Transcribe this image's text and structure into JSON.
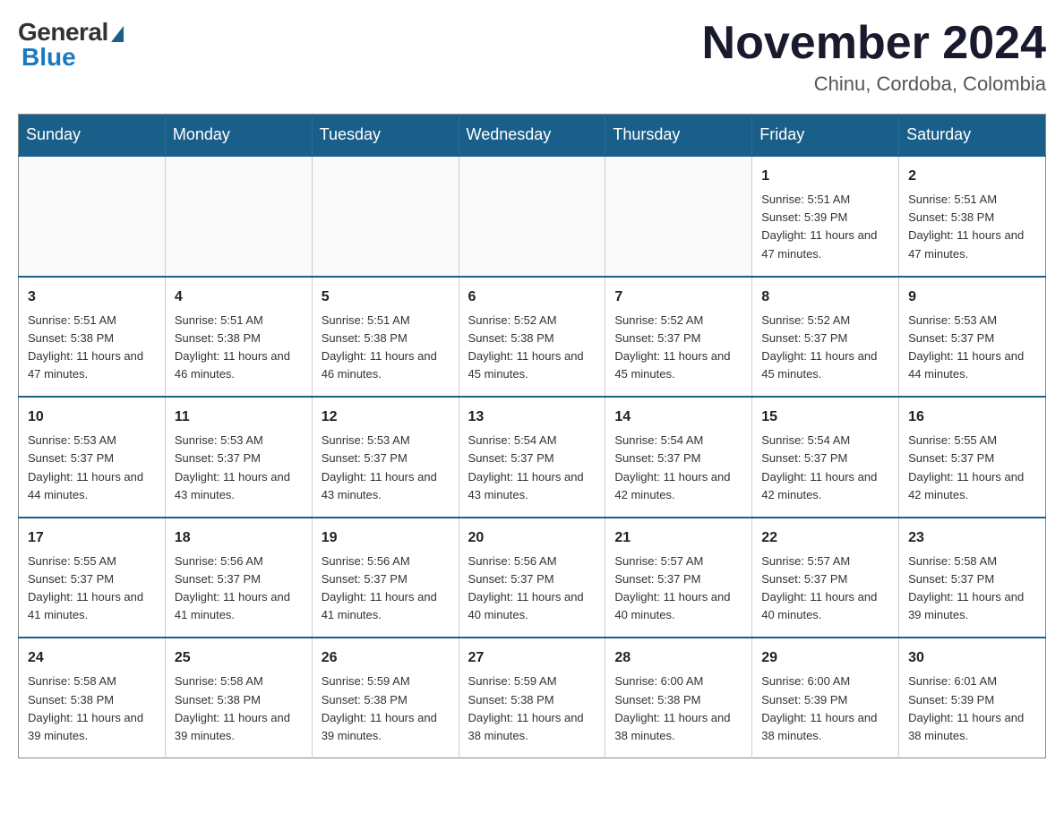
{
  "header": {
    "logo": {
      "general": "General",
      "blue": "Blue"
    },
    "title": "November 2024",
    "location": "Chinu, Cordoba, Colombia"
  },
  "weekdays": [
    "Sunday",
    "Monday",
    "Tuesday",
    "Wednesday",
    "Thursday",
    "Friday",
    "Saturday"
  ],
  "weeks": [
    [
      {
        "day": "",
        "info": ""
      },
      {
        "day": "",
        "info": ""
      },
      {
        "day": "",
        "info": ""
      },
      {
        "day": "",
        "info": ""
      },
      {
        "day": "",
        "info": ""
      },
      {
        "day": "1",
        "info": "Sunrise: 5:51 AM\nSunset: 5:39 PM\nDaylight: 11 hours and 47 minutes."
      },
      {
        "day": "2",
        "info": "Sunrise: 5:51 AM\nSunset: 5:38 PM\nDaylight: 11 hours and 47 minutes."
      }
    ],
    [
      {
        "day": "3",
        "info": "Sunrise: 5:51 AM\nSunset: 5:38 PM\nDaylight: 11 hours and 47 minutes."
      },
      {
        "day": "4",
        "info": "Sunrise: 5:51 AM\nSunset: 5:38 PM\nDaylight: 11 hours and 46 minutes."
      },
      {
        "day": "5",
        "info": "Sunrise: 5:51 AM\nSunset: 5:38 PM\nDaylight: 11 hours and 46 minutes."
      },
      {
        "day": "6",
        "info": "Sunrise: 5:52 AM\nSunset: 5:38 PM\nDaylight: 11 hours and 45 minutes."
      },
      {
        "day": "7",
        "info": "Sunrise: 5:52 AM\nSunset: 5:37 PM\nDaylight: 11 hours and 45 minutes."
      },
      {
        "day": "8",
        "info": "Sunrise: 5:52 AM\nSunset: 5:37 PM\nDaylight: 11 hours and 45 minutes."
      },
      {
        "day": "9",
        "info": "Sunrise: 5:53 AM\nSunset: 5:37 PM\nDaylight: 11 hours and 44 minutes."
      }
    ],
    [
      {
        "day": "10",
        "info": "Sunrise: 5:53 AM\nSunset: 5:37 PM\nDaylight: 11 hours and 44 minutes."
      },
      {
        "day": "11",
        "info": "Sunrise: 5:53 AM\nSunset: 5:37 PM\nDaylight: 11 hours and 43 minutes."
      },
      {
        "day": "12",
        "info": "Sunrise: 5:53 AM\nSunset: 5:37 PM\nDaylight: 11 hours and 43 minutes."
      },
      {
        "day": "13",
        "info": "Sunrise: 5:54 AM\nSunset: 5:37 PM\nDaylight: 11 hours and 43 minutes."
      },
      {
        "day": "14",
        "info": "Sunrise: 5:54 AM\nSunset: 5:37 PM\nDaylight: 11 hours and 42 minutes."
      },
      {
        "day": "15",
        "info": "Sunrise: 5:54 AM\nSunset: 5:37 PM\nDaylight: 11 hours and 42 minutes."
      },
      {
        "day": "16",
        "info": "Sunrise: 5:55 AM\nSunset: 5:37 PM\nDaylight: 11 hours and 42 minutes."
      }
    ],
    [
      {
        "day": "17",
        "info": "Sunrise: 5:55 AM\nSunset: 5:37 PM\nDaylight: 11 hours and 41 minutes."
      },
      {
        "day": "18",
        "info": "Sunrise: 5:56 AM\nSunset: 5:37 PM\nDaylight: 11 hours and 41 minutes."
      },
      {
        "day": "19",
        "info": "Sunrise: 5:56 AM\nSunset: 5:37 PM\nDaylight: 11 hours and 41 minutes."
      },
      {
        "day": "20",
        "info": "Sunrise: 5:56 AM\nSunset: 5:37 PM\nDaylight: 11 hours and 40 minutes."
      },
      {
        "day": "21",
        "info": "Sunrise: 5:57 AM\nSunset: 5:37 PM\nDaylight: 11 hours and 40 minutes."
      },
      {
        "day": "22",
        "info": "Sunrise: 5:57 AM\nSunset: 5:37 PM\nDaylight: 11 hours and 40 minutes."
      },
      {
        "day": "23",
        "info": "Sunrise: 5:58 AM\nSunset: 5:37 PM\nDaylight: 11 hours and 39 minutes."
      }
    ],
    [
      {
        "day": "24",
        "info": "Sunrise: 5:58 AM\nSunset: 5:38 PM\nDaylight: 11 hours and 39 minutes."
      },
      {
        "day": "25",
        "info": "Sunrise: 5:58 AM\nSunset: 5:38 PM\nDaylight: 11 hours and 39 minutes."
      },
      {
        "day": "26",
        "info": "Sunrise: 5:59 AM\nSunset: 5:38 PM\nDaylight: 11 hours and 39 minutes."
      },
      {
        "day": "27",
        "info": "Sunrise: 5:59 AM\nSunset: 5:38 PM\nDaylight: 11 hours and 38 minutes."
      },
      {
        "day": "28",
        "info": "Sunrise: 6:00 AM\nSunset: 5:38 PM\nDaylight: 11 hours and 38 minutes."
      },
      {
        "day": "29",
        "info": "Sunrise: 6:00 AM\nSunset: 5:39 PM\nDaylight: 11 hours and 38 minutes."
      },
      {
        "day": "30",
        "info": "Sunrise: 6:01 AM\nSunset: 5:39 PM\nDaylight: 11 hours and 38 minutes."
      }
    ]
  ]
}
